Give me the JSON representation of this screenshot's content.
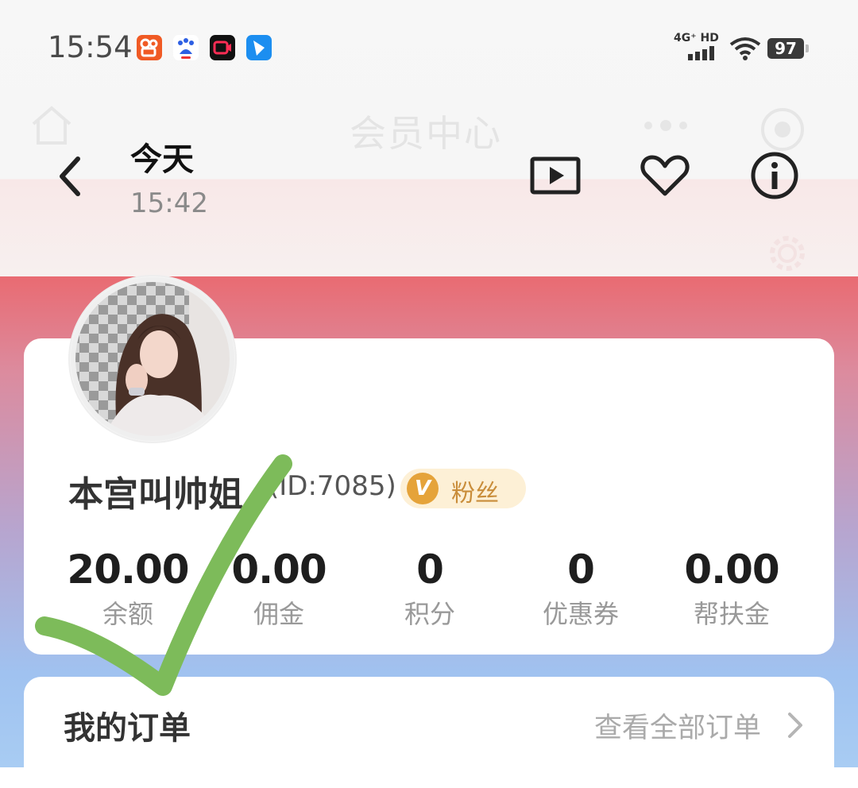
{
  "status_bar": {
    "time": "15:54",
    "network": "4G⁺ HD",
    "battery": "97",
    "app_icons": [
      "kuaishou-icon",
      "baidu-icon",
      "video-record-icon",
      "feishu-icon"
    ]
  },
  "underlying_page": {
    "title": "会员中心"
  },
  "viewer_header": {
    "day": "今天",
    "time": "15:42"
  },
  "profile": {
    "username": "本宫叫帅姐",
    "user_id": "(ID:7085)",
    "badge_letter": "V",
    "badge_label": "粉丝"
  },
  "stats": [
    {
      "value": "20.00",
      "label": "余额"
    },
    {
      "value": "0.00",
      "label": "佣金"
    },
    {
      "value": "0",
      "label": "积分"
    },
    {
      "value": "0",
      "label": "优惠券"
    },
    {
      "value": "0.00",
      "label": "帮扶金"
    }
  ],
  "orders": {
    "title": "我的订单",
    "view_all": "查看全部订单"
  },
  "colors": {
    "header_red": "#e96b72",
    "bottom_blue": "#a8ccf3",
    "badge_gold": "#e5a33a",
    "check_green": "#7dbb5a"
  }
}
